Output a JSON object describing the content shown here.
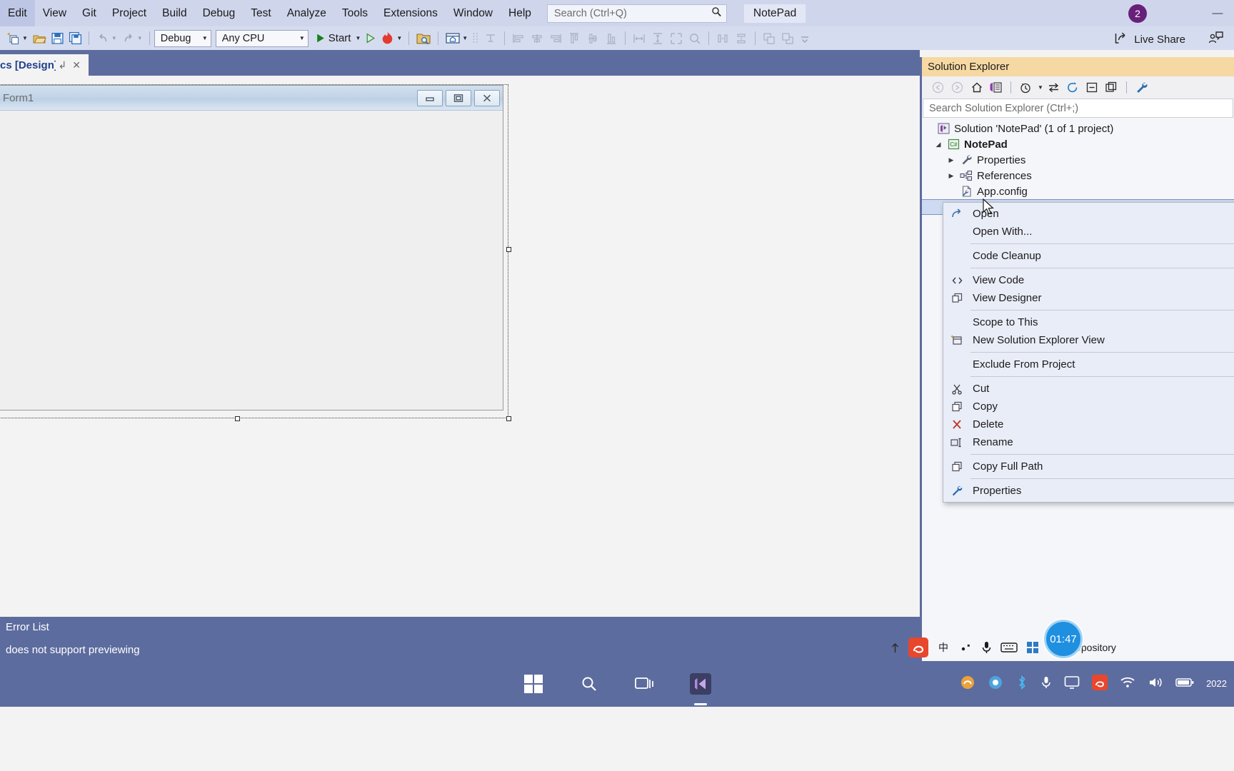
{
  "menubar": {
    "items": [
      "Edit",
      "View",
      "Git",
      "Project",
      "Build",
      "Debug",
      "Test",
      "Analyze",
      "Tools",
      "Extensions",
      "Window",
      "Help"
    ],
    "search_placeholder": "Search (Ctrl+Q)",
    "app_title": "NotePad",
    "account_badge": "2",
    "minimize_label": "—"
  },
  "toolbar": {
    "config_value": "Debug",
    "platform_value": "Any CPU",
    "start_label": "Start",
    "live_share_label": "Live Share"
  },
  "tab": {
    "label": "cs [Design]",
    "pin_glyph": "↲",
    "close_glyph": "✕"
  },
  "designer": {
    "form_title": "Form1"
  },
  "error_pane": {
    "title": "Error List",
    "status_message": "does not support previewing"
  },
  "solution_explorer": {
    "title": "Solution Explorer",
    "search_placeholder": "Search Solution Explorer (Ctrl+;)",
    "tree": [
      {
        "label": "Solution 'NotePad' (1 of 1 project)",
        "indent": 0,
        "twist": "",
        "icon": "solution-icon",
        "bold": false,
        "selected": false
      },
      {
        "label": "NotePad",
        "indent": 1,
        "twist": "◢",
        "icon": "csharp-project-icon",
        "bold": true,
        "selected": false
      },
      {
        "label": "Properties",
        "indent": 2,
        "twist": "▶",
        "icon": "wrench-icon",
        "bold": false,
        "selected": false
      },
      {
        "label": "References",
        "indent": 2,
        "twist": "▶",
        "icon": "references-icon",
        "bold": false,
        "selected": false
      },
      {
        "label": "App.config",
        "indent": 2,
        "twist": "",
        "icon": "config-file-icon",
        "bold": false,
        "selected": false
      },
      {
        "label": "",
        "indent": 2,
        "twist": "▶",
        "icon": "form-file-icon",
        "bold": false,
        "selected": true
      }
    ]
  },
  "context_menu": {
    "items": [
      {
        "label": "Open",
        "icon": "open-icon",
        "sep_after": false
      },
      {
        "label": "Open With...",
        "icon": "",
        "sep_after": true
      },
      {
        "label": "Code Cleanup",
        "icon": "",
        "sep_after": true
      },
      {
        "label": "View Code",
        "icon": "view-code-icon",
        "sep_after": false
      },
      {
        "label": "View Designer",
        "icon": "view-designer-icon",
        "sep_after": true
      },
      {
        "label": "Scope to This",
        "icon": "",
        "sep_after": false
      },
      {
        "label": "New Solution Explorer View",
        "icon": "new-view-icon",
        "sep_after": true
      },
      {
        "label": "Exclude From Project",
        "icon": "",
        "sep_after": true
      },
      {
        "label": "Cut",
        "icon": "scissors-icon",
        "sep_after": false
      },
      {
        "label": "Copy",
        "icon": "copy-icon",
        "sep_after": false
      },
      {
        "label": "Delete",
        "icon": "delete-x-icon",
        "sep_after": false
      },
      {
        "label": "Rename",
        "icon": "rename-icon",
        "sep_after": true
      },
      {
        "label": "Copy Full Path",
        "icon": "copy-path-icon",
        "sep_after": true
      },
      {
        "label": "Properties",
        "icon": "properties-icon",
        "sep_after": false
      }
    ]
  },
  "tray": {
    "repository_label": "Repository",
    "clock_badge": "01:47",
    "date_text": "2022"
  },
  "colors": {
    "menubar_bg": "#cfd6ec",
    "toolbar_bg": "#d6dcef",
    "accent_blue": "#5d6c9e",
    "se_header_bg": "#f6d8a2",
    "selection_bg": "#cddaf1",
    "account_purple": "#68217a",
    "delete_red": "#c0392b",
    "start_green": "#2e8b2e"
  }
}
